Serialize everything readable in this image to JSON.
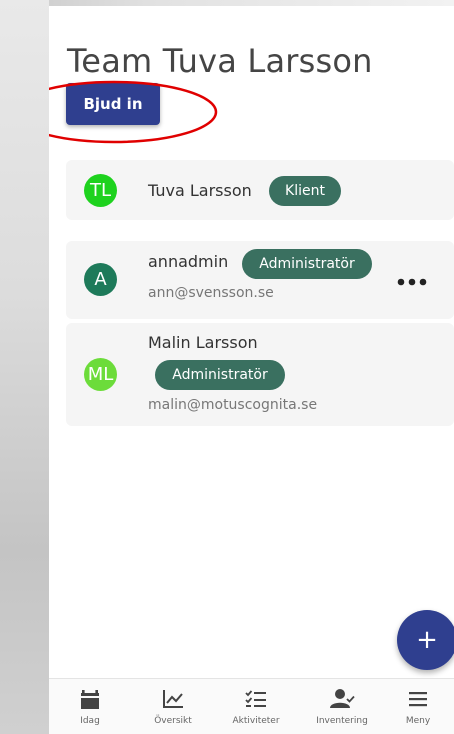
{
  "team": {
    "title": "Team Tuva Larsson",
    "invite_label": "Bjud in"
  },
  "members": [
    {
      "initials": "TL",
      "name": "Tuva Larsson",
      "role": "Klient",
      "email": "",
      "avatar_color": "#1ed21e"
    },
    {
      "initials": "A",
      "name": "annadmin",
      "role": "Administratör",
      "email": "ann@svensson.se",
      "avatar_color": "#1e7a5a"
    },
    {
      "initials": "ML",
      "name": "Malin Larsson",
      "role": "Administratör",
      "email": "malin@motuscognita.se",
      "avatar_color": "#6cdc3a"
    }
  ],
  "fab": {
    "label": "+"
  },
  "nav": [
    {
      "label": "Idag",
      "icon": "calendar-icon"
    },
    {
      "label": "Översikt",
      "icon": "chart-icon"
    },
    {
      "label": "Aktiviteter",
      "icon": "checklist-icon"
    },
    {
      "label": "Inventering",
      "icon": "person-check-icon"
    },
    {
      "label": "Meny",
      "icon": "menu-icon"
    }
  ],
  "colors": {
    "primary": "#2f3f8f",
    "badge": "#3a7060",
    "highlight": "#e00000"
  }
}
